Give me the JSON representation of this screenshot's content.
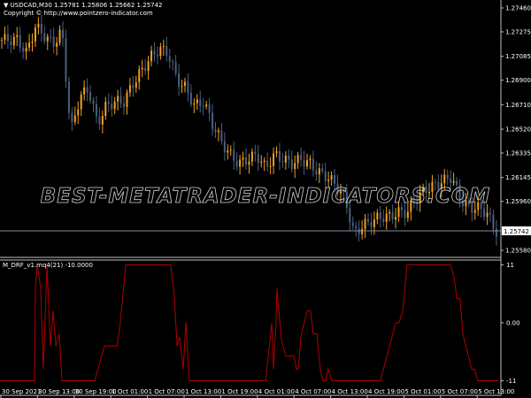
{
  "header": {
    "symbol_line": "USDCAD,M30  1.25781 1.25806 1.25662 1.25742",
    "copyright": "Copyright © http://www.pointzero-indicator.com"
  },
  "watermark": "BEST-METATRADER-INDICATORS.COM",
  "colors": {
    "background": "#000000",
    "bull": "#f0a020",
    "bear": "#4a6080",
    "indicator": "#b00000",
    "axis": "#c0c0c0",
    "price_line": "#8090a0"
  },
  "chart_data": [
    {
      "type": "candlestick",
      "symbol": "USDCAD",
      "timeframe": "M30",
      "price_ticks": [
        "1.27460",
        "1.27275",
        "1.27085",
        "1.26900",
        "1.26710",
        "1.26520",
        "1.26335",
        "1.26145",
        "1.25960",
        "1.25580"
      ],
      "current_price": "1.25742",
      "ylim": [
        1.2554,
        1.2758
      ],
      "close": [
        1.27213,
        1.27213,
        1.27213,
        1.2711,
        1.27316,
        1.27247,
        1.27179,
        1.27282,
        1.26493,
        1.26767,
        1.26836,
        1.26561,
        1.26699,
        1.26733,
        1.26733,
        1.2687,
        1.26973,
        1.27076,
        1.27144,
        1.2711,
        1.26904,
        1.26836,
        1.26699,
        1.26733,
        1.26561,
        1.26424,
        1.26321,
        1.26253,
        1.26287,
        1.26321,
        1.26218,
        1.26321,
        1.26287,
        1.26253,
        1.26287,
        1.26253,
        1.26184,
        1.2615,
        1.26081,
        1.25978,
        1.25704,
        1.25772,
        1.25807,
        1.25841,
        1.25841,
        1.25875,
        1.25875,
        1.25978,
        1.26047,
        1.26081,
        1.26115,
        1.2615,
        1.25978,
        1.2591,
        1.2591,
        1.25875,
        1.25724
      ]
    },
    {
      "type": "line",
      "title": "M_DRF_v1.mq4(21) -10.0000",
      "yticks": [
        "11",
        "0.00",
        "-11"
      ],
      "ylim": [
        -11,
        11
      ],
      "xlabel_ticks": [
        "30 Sep 2021",
        "30 Sep 13:00",
        "30 Sep 19:00",
        "1 Oct 01:00",
        "1 Oct 07:00",
        "1 Oct 13:00",
        "1 Oct 19:00",
        "4 Oct 01:00",
        "4 Oct 07:00",
        "4 Oct 13:00",
        "4 Oct 19:00",
        "5 Oct 01:00",
        "5 Oct 07:00",
        "5 Oct 13:00"
      ],
      "series": [
        {
          "bars": [
            0,
            11.3,
            11.6,
            12.2,
            13.3,
            14.2,
            15.4,
            16.5,
            17.4,
            18.3,
            19.4,
            20.3,
            31,
            34.2,
            38.3,
            39.1,
            41.2,
            55.9,
            57.1,
            58,
            58.8,
            60,
            60.9,
            62,
            87,
            89,
            89.6,
            90.4,
            90.7,
            92.2,
            93.6,
            96.2,
            97.1,
            97.7,
            98.6,
            100.6,
            101.7,
            102.6,
            103.8,
            104.9,
            105.8,
            106.7,
            107.5,
            108.7,
            124.6,
            129.6,
            130.7,
            131.9,
            133.3,
            147.5,
            148.7,
            149.6,
            150.7,
            151.6,
            154.5,
            155.4,
            156.5,
            163.2
          ],
          "values": [
            -11,
            -11,
            6.8,
            11,
            6.8,
            -8.8,
            11,
            -4.4,
            2.3,
            -4.4,
            -2.1,
            -11,
            -11,
            -4.4,
            -4.4,
            -1.6,
            11,
            11,
            5.1,
            -4.4,
            -2.7,
            -8.8,
            0.1,
            -11,
            -11,
            0,
            -8.8,
            0,
            6.5,
            -3.3,
            -6.3,
            -6.3,
            -8.8,
            -8.8,
            -2.4,
            2.3,
            2.3,
            -2.1,
            -2.1,
            -8.8,
            -11,
            -11,
            -8.8,
            -11,
            -11,
            0,
            0,
            2.3,
            11,
            11,
            8.8,
            4.6,
            4.6,
            -2.1,
            -8.8,
            -8.8,
            -11,
            -11
          ]
        }
      ]
    }
  ]
}
